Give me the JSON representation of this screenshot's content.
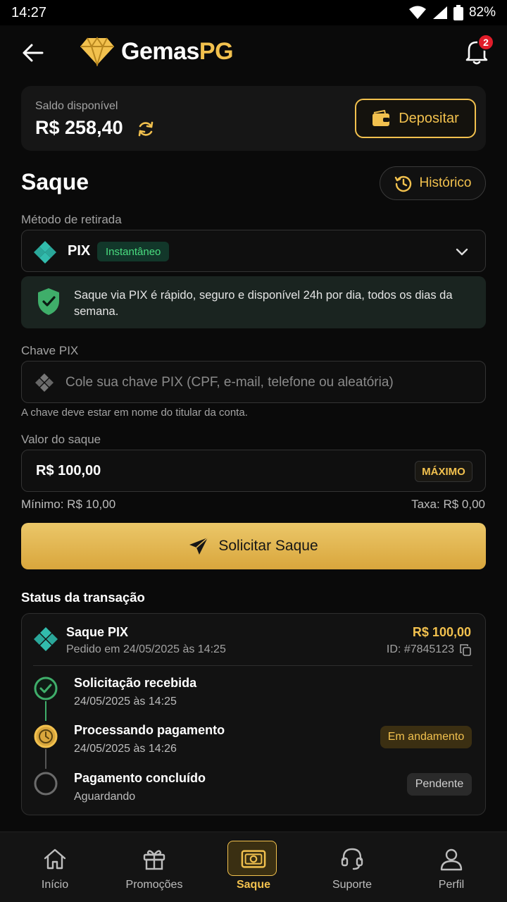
{
  "status_bar": {
    "time": "14:27",
    "battery": "82%"
  },
  "header": {
    "logo_main": "Gemas",
    "logo_accent": "PG",
    "notification_count": "2"
  },
  "balance": {
    "label": "Saldo disponível",
    "value": "R$ 258,40",
    "deposit_label": "Depositar"
  },
  "page": {
    "title": "Saque",
    "history_label": "Histórico"
  },
  "method": {
    "label": "Método de retirada",
    "name": "PIX",
    "badge": "Instantâneo"
  },
  "info": {
    "text": "Saque via PIX é rápido, seguro e disponível 24h por dia, todos os dias da semana."
  },
  "pix_key": {
    "label": "Chave PIX",
    "placeholder": "Cole sua chave PIX (CPF, e-mail, telefone ou aleatória)",
    "hint": "A chave deve estar em nome do titular da conta."
  },
  "amount": {
    "label": "Valor do saque",
    "value": "R$ 100,00",
    "max_label": "MÁXIMO",
    "minimum": "Mínimo: R$ 10,00",
    "fee": "Taxa: R$ 0,00"
  },
  "submit": {
    "label": "Solicitar Saque"
  },
  "transaction": {
    "section_title": "Status da transação",
    "title": "Saque PIX",
    "date": "Pedido em 24/05/2025 às 14:25",
    "amount": "R$ 100,00",
    "id": "ID: #7845123",
    "steps": [
      {
        "title": "Solicitação recebida",
        "sub": "24/05/2025 às 14:25"
      },
      {
        "title": "Processando pagamento",
        "sub": "24/05/2025 às 14:26",
        "badge": "Em andamento"
      },
      {
        "title": "Pagamento concluído",
        "sub": "Aguardando",
        "badge": "Pendente"
      }
    ]
  },
  "nav": [
    {
      "label": "Início",
      "icon": "home-icon"
    },
    {
      "label": "Promoções",
      "icon": "gift-icon"
    },
    {
      "label": "Saque",
      "icon": "cash-icon"
    },
    {
      "label": "Suporte",
      "icon": "headset-icon"
    },
    {
      "label": "Perfil",
      "icon": "user-icon"
    }
  ],
  "colors": {
    "accent": "#f2c14e",
    "success": "#4ade80",
    "danger": "#e11d2a"
  }
}
